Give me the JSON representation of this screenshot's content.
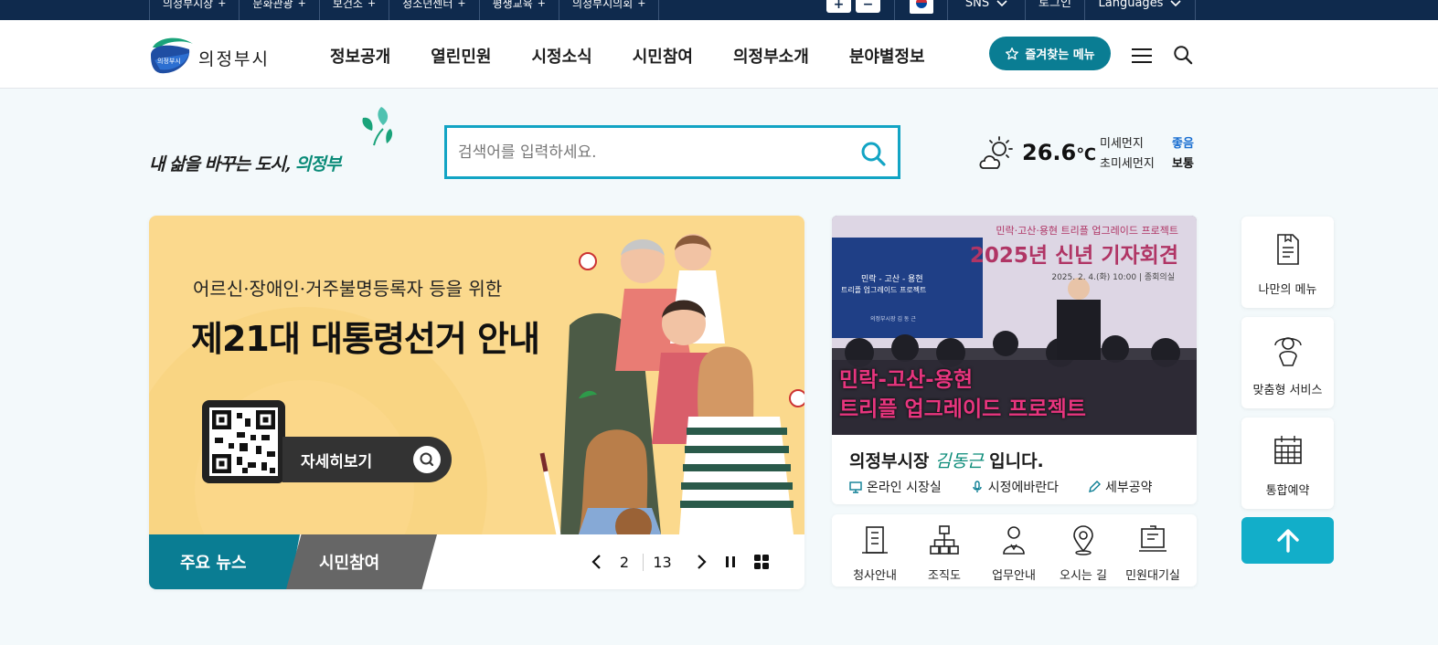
{
  "topbar": {
    "site_links": [
      "의정부시장",
      "문화관광",
      "보건소",
      "청소년센터",
      "평생교육",
      "의정부시의회"
    ],
    "zoom_in": "+",
    "zoom_out": "−",
    "sns_label": "SNS",
    "login_label": "로그인",
    "languages_label": "Languages"
  },
  "header": {
    "logo_text": "의정부시",
    "nav": [
      "정보공개",
      "열린민원",
      "시정소식",
      "시민참여",
      "의정부소개",
      "분야별정보"
    ],
    "favorites_label": "즐겨찾는 메뉴"
  },
  "slogan": {
    "text_prefix": "내 삶을 바꾸는 도시,",
    "text_city": "의정부"
  },
  "search": {
    "placeholder": "검색어를 입력하세요."
  },
  "weather": {
    "temperature": "26.6",
    "unit": "℃",
    "fine_dust_label": "미세먼지",
    "fine_dust_value": "좋음",
    "ultra_fine_dust_label": "초미세먼지",
    "ultra_fine_dust_value": "보통",
    "icon": "partly-cloudy-icon"
  },
  "banner": {
    "subtitle": "어르신·장애인·거주불명등록자 등을 위한",
    "title": "제21대 대통령선거 안내",
    "more_label": "자세히보기",
    "tabs": [
      "주요 뉴스",
      "시민참여"
    ],
    "current_page": "2",
    "total_pages": "13"
  },
  "mayor": {
    "photo_caption_top": "민락·고산·용현 트리플 업그레이드 프로젝트",
    "photo_title": "2025년 신년 기자회견",
    "photo_date": "2025. 2. 4.(화) 10:00 | 종회의실",
    "photo_banner_line1": "민락-고산-용현",
    "photo_banner_line2": "트리플 업그레이드 프로젝트",
    "screen_text_1": "민락 - 고산 - 용현",
    "screen_text_2": "트리플 업그레이드 프로젝트",
    "screen_text_3": "의정부시장 김 동 근",
    "name_prefix": "의정부시장",
    "name": "김동근",
    "name_suffix": "입니다.",
    "links": [
      "온라인 시장실",
      "시정에바란다",
      "세부공약"
    ]
  },
  "quick_links": [
    "청사안내",
    "조직도",
    "업무안내",
    "오시는 길",
    "민원대기실"
  ],
  "side_panel": [
    "나만의 메뉴",
    "맞춤형 서비스",
    "통합예약"
  ],
  "colors": {
    "topbar": "#0f2a4d",
    "primary": "#0a7d93",
    "search_border": "#12a4c4",
    "banner_bg": "#fbd98d",
    "good": "#1a6fd1",
    "top_button": "#12aec9"
  }
}
